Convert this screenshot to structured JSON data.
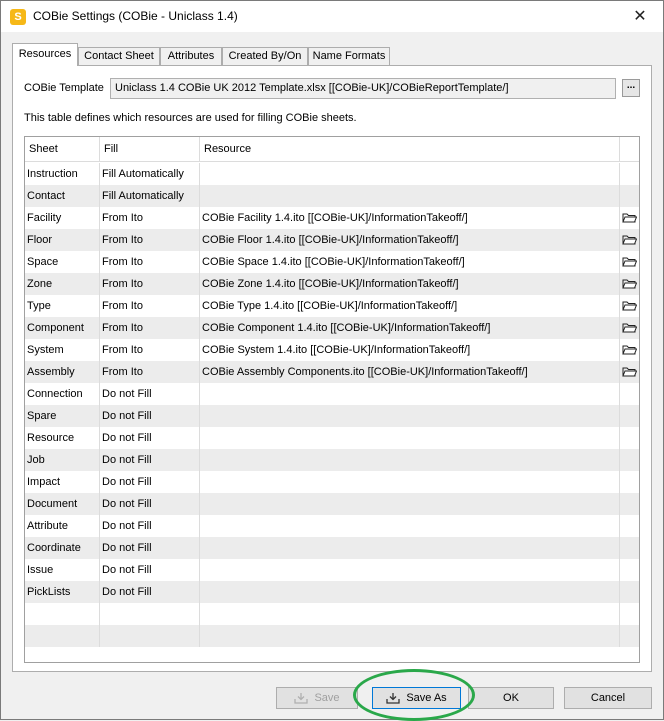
{
  "window": {
    "app_icon_letter": "S",
    "title": "COBie Settings (COBie - Uniclass 1.4)",
    "close_glyph": "✕"
  },
  "tabs": [
    {
      "label": "Resources",
      "active": true
    },
    {
      "label": "Contact Sheet",
      "active": false
    },
    {
      "label": "Attributes",
      "active": false
    },
    {
      "label": "Created By/On",
      "active": false
    },
    {
      "label": "Name Formats",
      "active": false
    }
  ],
  "template": {
    "label": "COBie Template",
    "value": "Uniclass 1.4 COBie UK 2012 Template.xlsx [[COBie-UK]/COBieReportTemplate/]",
    "browse_label": "..."
  },
  "description": "This table defines which resources are used for filling COBie sheets.",
  "table": {
    "columns": [
      "Sheet",
      "Fill",
      "Resource"
    ],
    "rows": [
      {
        "sheet": "Instruction",
        "fill": "Fill Automatically",
        "resource": "",
        "icon": ""
      },
      {
        "sheet": "Contact",
        "fill": "Fill Automatically",
        "resource": "",
        "icon": ""
      },
      {
        "sheet": "Facility",
        "fill": "From Ito",
        "resource": "COBie Facility 1.4.ito [[COBie-UK]/InformationTakeoff/]",
        "icon": "folder-icon"
      },
      {
        "sheet": "Floor",
        "fill": "From Ito",
        "resource": "COBie Floor 1.4.ito [[COBie-UK]/InformationTakeoff/]",
        "icon": "folder-icon"
      },
      {
        "sheet": "Space",
        "fill": "From Ito",
        "resource": "COBie Space 1.4.ito [[COBie-UK]/InformationTakeoff/]",
        "icon": "folder-icon"
      },
      {
        "sheet": "Zone",
        "fill": "From Ito",
        "resource": "COBie Zone 1.4.ito [[COBie-UK]/InformationTakeoff/]",
        "icon": "folder-icon"
      },
      {
        "sheet": "Type",
        "fill": "From Ito",
        "resource": "COBie Type 1.4.ito [[COBie-UK]/InformationTakeoff/]",
        "icon": "folder-icon"
      },
      {
        "sheet": "Component",
        "fill": "From Ito",
        "resource": "COBie Component 1.4.ito [[COBie-UK]/InformationTakeoff/]",
        "icon": "folder-icon"
      },
      {
        "sheet": "System",
        "fill": "From Ito",
        "resource": "COBie System 1.4.ito [[COBie-UK]/InformationTakeoff/]",
        "icon": "folder-icon"
      },
      {
        "sheet": "Assembly",
        "fill": "From Ito",
        "resource": "COBie Assembly Components.ito [[COBie-UK]/InformationTakeoff/]",
        "icon": "folder-icon"
      },
      {
        "sheet": "Connection",
        "fill": "Do not Fill",
        "resource": "",
        "icon": ""
      },
      {
        "sheet": "Spare",
        "fill": "Do not Fill",
        "resource": "",
        "icon": ""
      },
      {
        "sheet": "Resource",
        "fill": "Do not Fill",
        "resource": "",
        "icon": ""
      },
      {
        "sheet": "Job",
        "fill": "Do not Fill",
        "resource": "",
        "icon": ""
      },
      {
        "sheet": "Impact",
        "fill": "Do not Fill",
        "resource": "",
        "icon": ""
      },
      {
        "sheet": "Document",
        "fill": "Do not Fill",
        "resource": "",
        "icon": ""
      },
      {
        "sheet": "Attribute",
        "fill": "Do not Fill",
        "resource": "",
        "icon": ""
      },
      {
        "sheet": "Coordinate",
        "fill": "Do not Fill",
        "resource": "",
        "icon": ""
      },
      {
        "sheet": "Issue",
        "fill": "Do not Fill",
        "resource": "",
        "icon": ""
      },
      {
        "sheet": "PickLists",
        "fill": "Do not Fill",
        "resource": "",
        "icon": ""
      }
    ]
  },
  "footer": {
    "save_label": "Save",
    "save_as_label": "Save As",
    "ok_label": "OK",
    "cancel_label": "Cancel"
  },
  "colors": {
    "highlight_ring": "#2aa84a",
    "focus_border": "#0078d7",
    "app_icon": "#f6b817"
  }
}
